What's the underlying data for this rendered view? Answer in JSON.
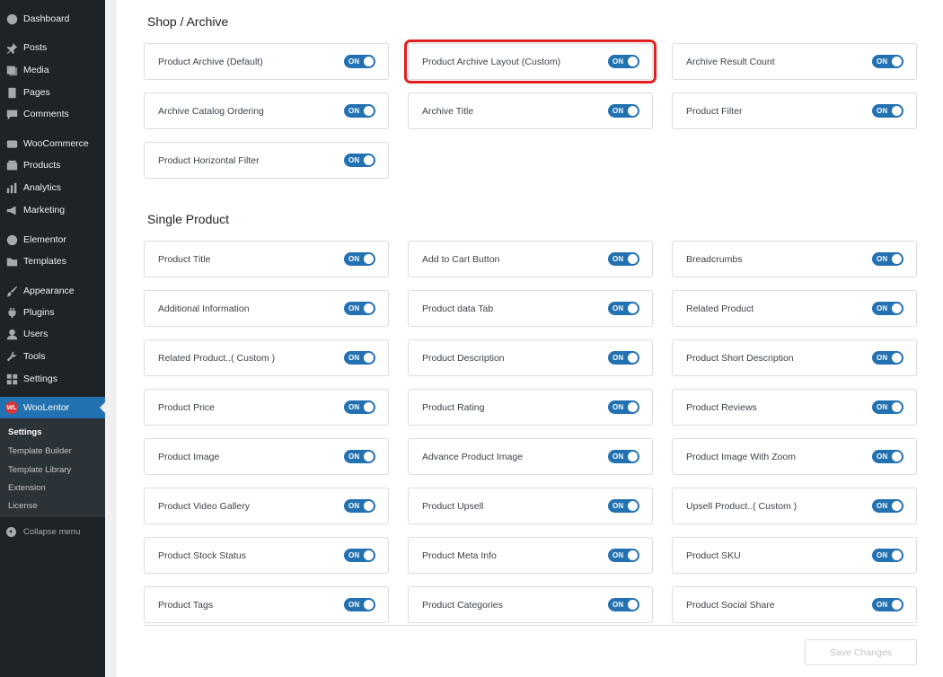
{
  "sidebar": {
    "items": [
      {
        "label": "Dashboard",
        "icon": "dashboard-icon"
      },
      {
        "label": "Posts",
        "icon": "pin-icon"
      },
      {
        "label": "Media",
        "icon": "media-icon"
      },
      {
        "label": "Pages",
        "icon": "pages-icon"
      },
      {
        "label": "Comments",
        "icon": "comments-icon"
      },
      {
        "label": "WooCommerce",
        "icon": "woocommerce-icon"
      },
      {
        "label": "Products",
        "icon": "products-icon"
      },
      {
        "label": "Analytics",
        "icon": "analytics-icon"
      },
      {
        "label": "Marketing",
        "icon": "megaphone-icon"
      },
      {
        "label": "Elementor",
        "icon": "elementor-icon"
      },
      {
        "label": "Templates",
        "icon": "folder-icon"
      },
      {
        "label": "Appearance",
        "icon": "brush-icon"
      },
      {
        "label": "Plugins",
        "icon": "plug-icon"
      },
      {
        "label": "Users",
        "icon": "user-icon"
      },
      {
        "label": "Tools",
        "icon": "wrench-icon"
      },
      {
        "label": "Settings",
        "icon": "settings-icon"
      },
      {
        "label": "WooLentor",
        "icon": "woolentor-logo-icon",
        "logo_text": "WL"
      }
    ],
    "submenu": [
      "Settings",
      "Template Builder",
      "Template Library",
      "Extension",
      "License"
    ],
    "collapse_label": "Collapse menu"
  },
  "sections": [
    {
      "title": "Shop / Archive",
      "items": [
        "Product Archive (Default)",
        "Product Archive Layout (Custom)",
        "Archive Result Count",
        "Archive Catalog Ordering",
        "Archive Title",
        "Product Filter",
        "Product Horizontal Filter"
      ]
    },
    {
      "title": "Single Product",
      "items": [
        "Product Title",
        "Add to Cart Button",
        "Breadcrumbs",
        "Additional Information",
        "Product data Tab",
        "Related Product",
        "Related Product..( Custom )",
        "Product Description",
        "Product Short Description",
        "Product Price",
        "Product Rating",
        "Product Reviews",
        "Product Image",
        "Advance Product Image",
        "Product Image With Zoom",
        "Product Video Gallery",
        "Product Upsell",
        "Upsell Product..( Custom )",
        "Product Stock Status",
        "Product Meta Info",
        "Product SKU",
        "Product Tags",
        "Product Categories",
        "Product Social Share"
      ]
    }
  ],
  "toggle_label": "ON",
  "highlighted_item": "Product Archive Layout (Custom)",
  "save_label": "Save Changes",
  "colors": {
    "accent": "#2271b1",
    "highlight": "#e02020",
    "sidebar": "#1d2327"
  }
}
